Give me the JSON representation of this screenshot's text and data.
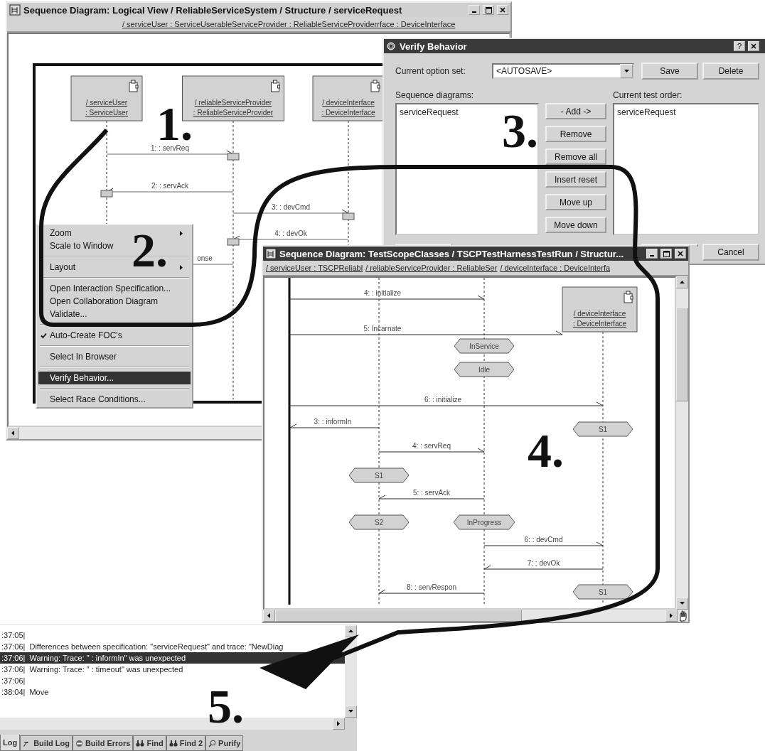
{
  "main_window": {
    "title": "Sequence Diagram: Logical View / ReliableServiceSystem / Structure / serviceRequest",
    "header": "/ serviceUser : ServiceUserableServiceProvider : ReliableServiceProviderrface : DeviceInterface",
    "objects": [
      {
        "name": "/ serviceUser",
        "class": ": ServiceUser"
      },
      {
        "name": "/ reliableServiceProvider",
        "class": ": ReliableServiceProvider"
      },
      {
        "name": "/ deviceInterface",
        "class": ": DeviceInterface"
      }
    ],
    "messages": [
      {
        "label": "1:  : servReq"
      },
      {
        "label": "2:  : servAck"
      },
      {
        "label": "3:  : devCmd"
      },
      {
        "label": "4:  : devOk"
      },
      {
        "label": "onse"
      }
    ]
  },
  "context_menu": {
    "items": [
      {
        "kind": "item",
        "label": "Zoom",
        "submenu": true,
        "checked": false,
        "selected": false
      },
      {
        "kind": "item",
        "label": "Scale to Window",
        "submenu": false,
        "checked": false,
        "selected": false
      },
      {
        "kind": "separator"
      },
      {
        "kind": "item",
        "label": "Layout",
        "submenu": true,
        "checked": false,
        "selected": false
      },
      {
        "kind": "separator"
      },
      {
        "kind": "item",
        "label": "Open Interaction Specification...",
        "submenu": false,
        "checked": false,
        "selected": false
      },
      {
        "kind": "item",
        "label": "Open Collaboration Diagram",
        "submenu": false,
        "checked": false,
        "selected": false
      },
      {
        "kind": "item",
        "label": "Validate...",
        "submenu": false,
        "checked": false,
        "selected": false
      },
      {
        "kind": "separator"
      },
      {
        "kind": "item",
        "label": "Auto-Create FOC's",
        "submenu": false,
        "checked": true,
        "selected": false
      },
      {
        "kind": "separator"
      },
      {
        "kind": "item",
        "label": "Select In Browser",
        "submenu": false,
        "checked": false,
        "selected": false
      },
      {
        "kind": "separator"
      },
      {
        "kind": "item",
        "label": "Verify Behavior...",
        "submenu": false,
        "checked": false,
        "selected": true
      },
      {
        "kind": "separator"
      },
      {
        "kind": "item",
        "label": "Select Race Conditions...",
        "submenu": false,
        "checked": false,
        "selected": false
      }
    ]
  },
  "verify_dialog": {
    "title": "Verify Behavior",
    "option_label": "Current option set:",
    "option_value": "<AUTOSAVE>",
    "save": "Save",
    "delete": "Delete",
    "help": "?",
    "sequence_label": "Sequence diagrams:",
    "sequence_items": [
      "serviceRequest"
    ],
    "order_label": "Current test order:",
    "order_items": [
      "serviceRequest"
    ],
    "side_buttons": [
      "- Add ->",
      "Remove",
      "Remove all",
      "Insert reset",
      "Move up",
      "Move down"
    ],
    "cancel": "Cancel"
  },
  "test_window": {
    "title": "Sequence Diagram: TestScopeClasses / TSCPTestHarnessTestRun / Structur...",
    "header": [
      "/ serviceUser : TSCPReliabl",
      "/ reliableServiceProvider : ReliableSer",
      "/ deviceInterface : DeviceInterfa"
    ],
    "object": {
      "name": "/ deviceInterface",
      "class": ": DeviceInterface"
    },
    "messages": [
      {
        "label": "4:  : initialize"
      },
      {
        "label": "5: Incarnate"
      },
      {
        "label": "6:  : initialize"
      },
      {
        "label": "3:  : informIn"
      },
      {
        "label": "4:  : servReq"
      },
      {
        "label": "5:  : servAck"
      },
      {
        "label": "6:  : devCmd"
      },
      {
        "label": "7:  : devOk"
      },
      {
        "label": "8:  : servRespon"
      }
    ],
    "states": [
      "InService",
      "Idle",
      "S1",
      "S1",
      "S2",
      "InProgress",
      "S1"
    ]
  },
  "log_panel": {
    "rows": [
      {
        "time": ":37:05|",
        "text": "",
        "selected": false
      },
      {
        "time": ":37:06|",
        "text": "Differences between specification: \"serviceRequest\" and trace: \"NewDiag",
        "selected": false
      },
      {
        "time": ":37:06|",
        "text": "Warning:    Trace:    \" : informIn\" was unexpected",
        "selected": true
      },
      {
        "time": ":37:06|",
        "text": "Warning:    Trace:    \" : timeout\" was unexpected",
        "selected": false
      },
      {
        "time": ":37:06|",
        "text": "",
        "selected": false
      },
      {
        "time": ":38:04|",
        "text": "Move",
        "selected": false
      }
    ],
    "tabs": [
      {
        "label": "Log",
        "selected": true
      },
      {
        "label": "Build Log",
        "selected": false
      },
      {
        "label": "Build Errors",
        "selected": false
      },
      {
        "label": "Find",
        "selected": false
      },
      {
        "label": "Find 2",
        "selected": false
      },
      {
        "label": "Purify",
        "selected": false
      }
    ]
  },
  "annotations": [
    "1.",
    "2.",
    "3.",
    "4.",
    "5."
  ]
}
